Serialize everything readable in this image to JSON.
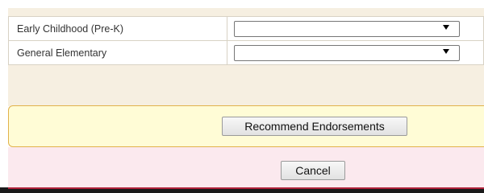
{
  "endorsements": {
    "rows": [
      {
        "label": "Early Childhood (Pre-K)",
        "selected": ""
      },
      {
        "label": "General Elementary",
        "selected": ""
      }
    ]
  },
  "actions": {
    "recommend_label": "Recommend Endorsements",
    "cancel_label": "Cancel"
  },
  "colors": {
    "panel_bg": "#f6efe1",
    "action_bar_bg": "#fffcd6",
    "action_bar_border": "#e1b24b",
    "cancel_bar_bg": "#fbe9ee",
    "bottom_accent": "#b0223a"
  },
  "icons": {
    "dropdown": "chevron-down-icon"
  }
}
